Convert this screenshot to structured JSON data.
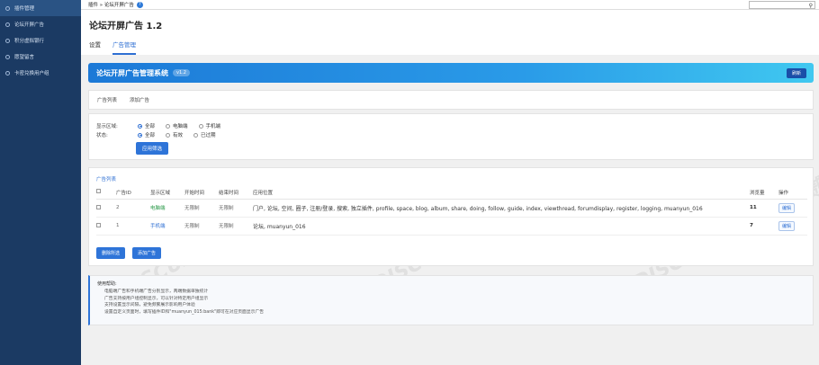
{
  "sidebar": {
    "items": [
      {
        "label": "插件管理",
        "active": true
      },
      {
        "label": "论坛开屏广告",
        "active": false
      },
      {
        "label": "积分虚拟银行",
        "active": false
      },
      {
        "label": "愿望留言",
        "active": false
      },
      {
        "label": "卡密兑换用户组",
        "active": false
      }
    ]
  },
  "topbar": {
    "breadcrumb": "插件 » 论坛开屏广告",
    "help_icon": "?",
    "search_placeholder": ""
  },
  "header": {
    "title": "论坛开屏广告 1.2",
    "tabs": [
      {
        "label": "设置",
        "active": false
      },
      {
        "label": "广告管理",
        "active": true
      }
    ]
  },
  "banner": {
    "title": "论坛开屏广告管理系统",
    "version": "v1.2",
    "refresh_label": "刷新",
    "gradient_start": "#1c79d7",
    "gradient_end": "#40c8f0"
  },
  "subtabs": [
    "广告列表",
    "添加广告"
  ],
  "filter": {
    "area_label": "显示区域:",
    "area_options": [
      "全部",
      "电脑端",
      "手机端"
    ],
    "area_selected": "全部",
    "status_label": "状态:",
    "status_options": [
      "全部",
      "有效",
      "已过期"
    ],
    "status_selected": "全部",
    "apply_label": "应用筛选"
  },
  "list": {
    "title": "广告列表",
    "headers": [
      "",
      "广告ID",
      "显示区域",
      "开始时间",
      "结束时间",
      "应用位置",
      "浏览量",
      "操作"
    ],
    "rows": [
      {
        "id": "2",
        "area": "电脑端",
        "start": "无限制",
        "end": "无限制",
        "position": "门户, 论坛, 空间, 圈子, 注册/登录, 搜索, 独立插件, profile, space, blog, album, share, doing, follow, guide, index, viewthread, forumdisplay, register, logging, muanyun_016",
        "views": "11",
        "action": "编辑"
      },
      {
        "id": "1",
        "area": "手机端",
        "start": "无限制",
        "end": "无限制",
        "position": "论坛, muanyun_016",
        "views": "7",
        "action": "编辑"
      }
    ],
    "delete_label": "删除所选",
    "add_label": "添加广告"
  },
  "notes": {
    "title": "使用帮助:",
    "lines": [
      "电脑端广告和手机端广告分别显示，两端数据单独统计",
      "广告支持按用户组控制显示，可以针对特定用户组显示",
      "支持设置显示间隔，避免频繁展示影响用户体验",
      "设置自定义页面时，填写插件ID和\"muanyun_015:bank\"即可在对应页面显示广告"
    ]
  },
  "watermark": "DISCUZ!应用中心 | 贰道"
}
